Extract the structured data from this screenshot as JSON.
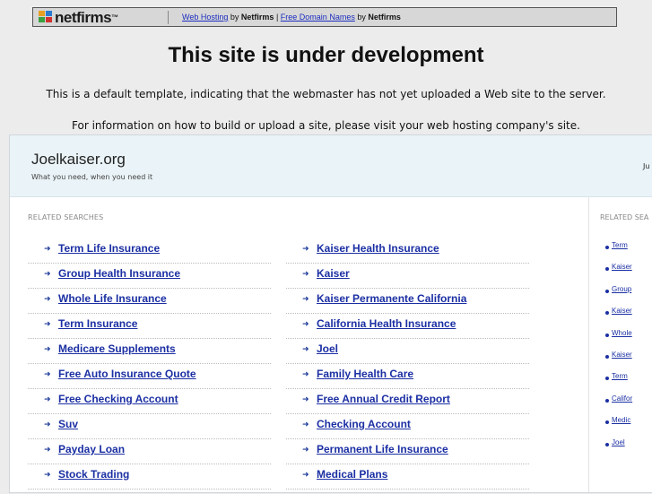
{
  "topbar": {
    "logo_text": "netfirms",
    "hosting_link": "Web Hosting",
    "hosting_by": "by",
    "hosting_brand": "Netfirms",
    "separator": "|",
    "domain_link": "Free Domain Names",
    "domain_by": "by",
    "domain_brand": "Netfirms"
  },
  "headline": "This site is under development",
  "line1": "This is a default template, indicating that the webmaster has not yet uploaded a Web site to the server.",
  "line2": "For information on how to build or upload a site, please visit your web hosting company's site.",
  "site": {
    "title": "Joelkaiser.org",
    "tagline": "What you need, when you need it",
    "header_right": "Ju"
  },
  "main": {
    "heading": "RELATED SEARCHES",
    "left_links": [
      "Term Life Insurance",
      "Group Health Insurance",
      "Whole Life Insurance",
      "Term Insurance",
      "Medicare Supplements",
      "Free Auto Insurance Quote",
      "Free Checking Account",
      "Suv",
      "Payday Loan",
      "Stock Trading"
    ],
    "right_links": [
      "Kaiser Health Insurance",
      "Kaiser",
      "Kaiser Permanente California",
      "California Health Insurance",
      "Joel",
      "Family Health Care",
      "Free Annual Credit Report",
      "Checking Account",
      "Permanent Life Insurance",
      "Medical Plans"
    ],
    "arrow": "➜"
  },
  "side": {
    "heading": "RELATED SEA",
    "links": [
      "Term",
      "Kaiser",
      "Group",
      "Kaiser",
      "Whole",
      "Kaiser",
      "Term",
      "Califor",
      "Medic",
      "Joel"
    ]
  }
}
